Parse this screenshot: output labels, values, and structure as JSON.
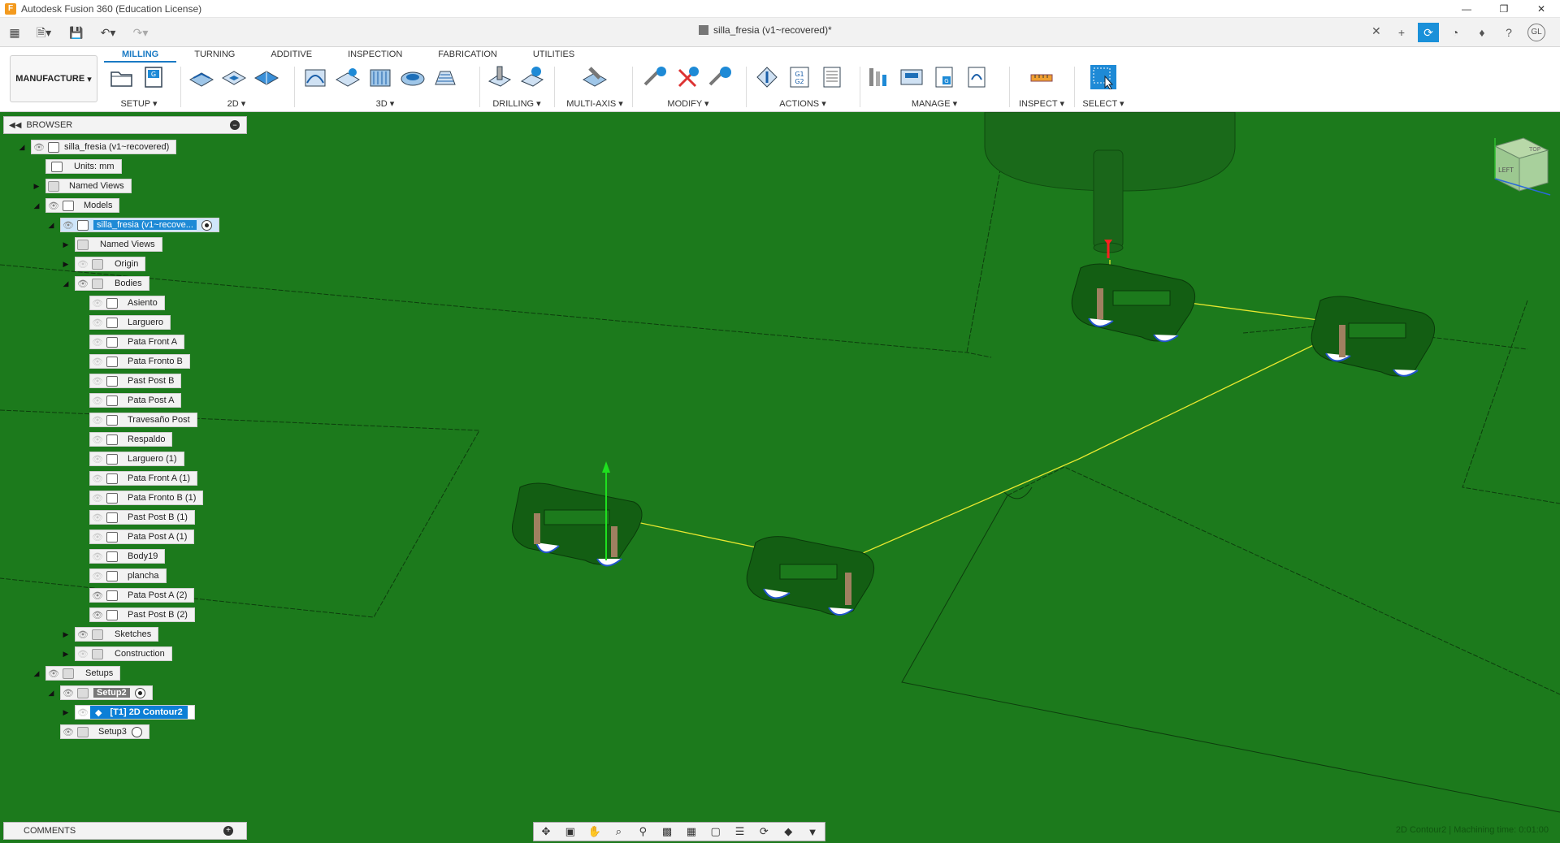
{
  "window": {
    "title": "Autodesk Fusion 360 (Education License)",
    "app_icon_letter": "F"
  },
  "document": {
    "tab_title": "silla_fresia (v1~recovered)*",
    "user_initials": "GL"
  },
  "ribbon": {
    "workspace_label": "MANUFACTURE",
    "tabs": [
      "MILLING",
      "TURNING",
      "ADDITIVE",
      "INSPECTION",
      "FABRICATION",
      "UTILITIES"
    ],
    "active_tab": "MILLING",
    "groups": {
      "setup": "SETUP",
      "2d": "2D",
      "3d": "3D",
      "drilling": "DRILLING",
      "multiaxis": "MULTI-AXIS",
      "modify": "MODIFY",
      "actions": "ACTIONS",
      "manage": "MANAGE",
      "inspect": "INSPECT",
      "select": "SELECT"
    },
    "gcode_label": "G1\nG2"
  },
  "browser": {
    "title": "BROWSER",
    "root": "silla_fresia (v1~recovered)",
    "units": "Units: mm",
    "named_views": "Named Views",
    "models": "Models",
    "component": "silla_fresia (v1~recove...",
    "named_views_inner": "Named Views",
    "origin": "Origin",
    "bodies": "Bodies",
    "body_list": [
      {
        "name": "Asiento",
        "visible": false
      },
      {
        "name": "Larguero",
        "visible": false
      },
      {
        "name": "Pata Front A",
        "visible": false
      },
      {
        "name": "Pata Fronto B",
        "visible": false
      },
      {
        "name": "Past Post B",
        "visible": false
      },
      {
        "name": "Pata Post A",
        "visible": false
      },
      {
        "name": "Travesaño Post",
        "visible": false
      },
      {
        "name": "Respaldo",
        "visible": false
      },
      {
        "name": "Larguero (1)",
        "visible": false
      },
      {
        "name": "Pata Front A (1)",
        "visible": false
      },
      {
        "name": "Pata Fronto B (1)",
        "visible": false
      },
      {
        "name": "Past Post B (1)",
        "visible": false
      },
      {
        "name": "Pata Post A (1)",
        "visible": false
      },
      {
        "name": "Body19",
        "visible": false
      },
      {
        "name": "plancha",
        "visible": false
      },
      {
        "name": "Pata Post A (2)",
        "visible": true
      },
      {
        "name": "Past Post B (2)",
        "visible": true
      }
    ],
    "sketches": "Sketches",
    "construction": "Construction",
    "setups": "Setups",
    "setup2": "Setup2",
    "operation": "[T1] 2D Contour2",
    "setup3": "Setup3"
  },
  "comments": {
    "title": "COMMENTS"
  },
  "viewcube": {
    "left_label": "LEFT",
    "top_label": "TOP"
  },
  "status": {
    "text": "2D Contour2 | Machining time: 0:01:00"
  },
  "colors": {
    "viewport_green": "#1c7a1c",
    "accent_blue": "#1a90d9",
    "toolpath_yellow": "#e8e830"
  }
}
